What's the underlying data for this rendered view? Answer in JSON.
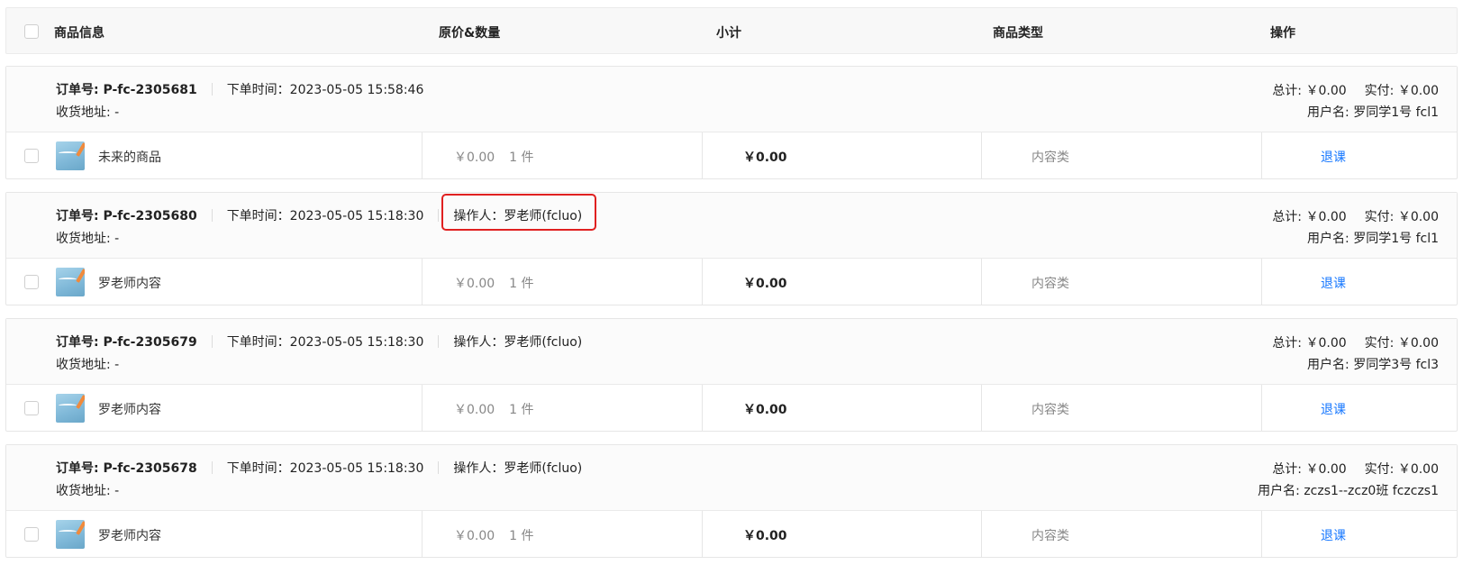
{
  "header": {
    "product_info": "商品信息",
    "price_qty": "原价&数量",
    "subtotal": "小计",
    "product_type": "商品类型",
    "action": "操作"
  },
  "orders": [
    {
      "order_no": "订单号: P-fc-2305681",
      "order_time": "下单时间：2023-05-05 15:58:46",
      "operator": "",
      "address": "收货地址: -",
      "total": "总计: ￥0.00",
      "paid": "实付: ￥0.00",
      "user": "用户名: 罗同学1号 fcl1",
      "product_name": "未来的商品",
      "price": "￥0.00",
      "qty": "1 件",
      "subtotal": "￥0.00",
      "type": "内容类",
      "action": "退课"
    },
    {
      "order_no": "订单号: P-fc-2305680",
      "order_time": "下单时间：2023-05-05 15:18:30",
      "operator": "操作人：罗老师(fcluo)",
      "address": "收货地址: -",
      "total": "总计: ￥0.00",
      "paid": "实付: ￥0.00",
      "user": "用户名: 罗同学1号 fcl1",
      "product_name": "罗老师内容",
      "price": "￥0.00",
      "qty": "1 件",
      "subtotal": "￥0.00",
      "type": "内容类",
      "action": "退课"
    },
    {
      "order_no": "订单号: P-fc-2305679",
      "order_time": "下单时间：2023-05-05 15:18:30",
      "operator": "操作人：罗老师(fcluo)",
      "address": "收货地址: -",
      "total": "总计: ￥0.00",
      "paid": "实付: ￥0.00",
      "user": "用户名: 罗同学3号 fcl3",
      "product_name": "罗老师内容",
      "price": "￥0.00",
      "qty": "1 件",
      "subtotal": "￥0.00",
      "type": "内容类",
      "action": "退课"
    },
    {
      "order_no": "订单号: P-fc-2305678",
      "order_time": "下单时间：2023-05-05 15:18:30",
      "operator": "操作人：罗老师(fcluo)",
      "address": "收货地址: -",
      "total": "总计: ￥0.00",
      "paid": "实付: ￥0.00",
      "user": "用户名: zczs1--zcz0班 fczczs1",
      "product_name": "罗老师内容",
      "price": "￥0.00",
      "qty": "1 件",
      "subtotal": "￥0.00",
      "type": "内容类",
      "action": "退课"
    }
  ],
  "colors": {
    "link": "#1677ff",
    "highlight_border": "#e02020",
    "muted_text": "#888888"
  }
}
